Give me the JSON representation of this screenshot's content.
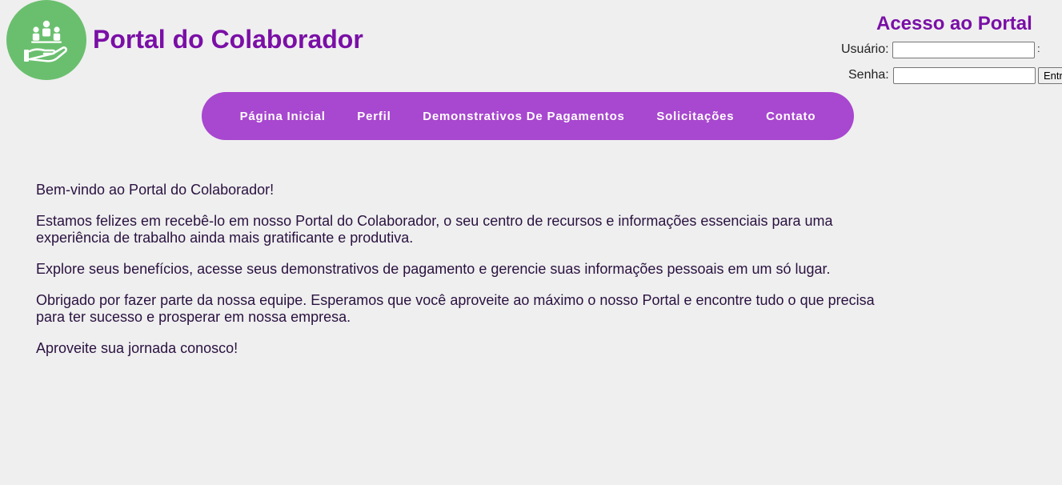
{
  "header": {
    "logo_icon": "team-helping-hand-icon",
    "title": "Portal do Colaborador",
    "brand_color": "#7a0fa6",
    "logo_color": "#6abf6e"
  },
  "login": {
    "title": "Acesso ao Portal",
    "username_label": "Usuário:",
    "username_value": "",
    "password_label": "Senha:",
    "password_value": "",
    "colon_text": ":",
    "submit_label": "Entrar"
  },
  "nav": {
    "color": "#a847cf",
    "items": [
      {
        "label": "Página Inicial"
      },
      {
        "label": "Perfil"
      },
      {
        "label": "Demonstrativos De Pagamentos"
      },
      {
        "label": "Solicitações"
      },
      {
        "label": "Contato"
      }
    ]
  },
  "main": {
    "paragraphs": [
      "Bem-vindo ao Portal do Colaborador!",
      "Estamos felizes em recebê-lo em nosso Portal do Colaborador, o seu centro de recursos e informações essenciais para uma experiência de trabalho ainda mais gratificante e produtiva.",
      "Explore seus benefícios, acesse seus demonstrativos de pagamento e gerencie suas informações pessoais em um só lugar.",
      "Obrigado por fazer parte da nossa equipe. Esperamos que você aproveite ao máximo o nosso Portal e encontre tudo o que precisa para ter sucesso e prosperar em nossa empresa.",
      "Aproveite sua jornada conosco!"
    ]
  }
}
